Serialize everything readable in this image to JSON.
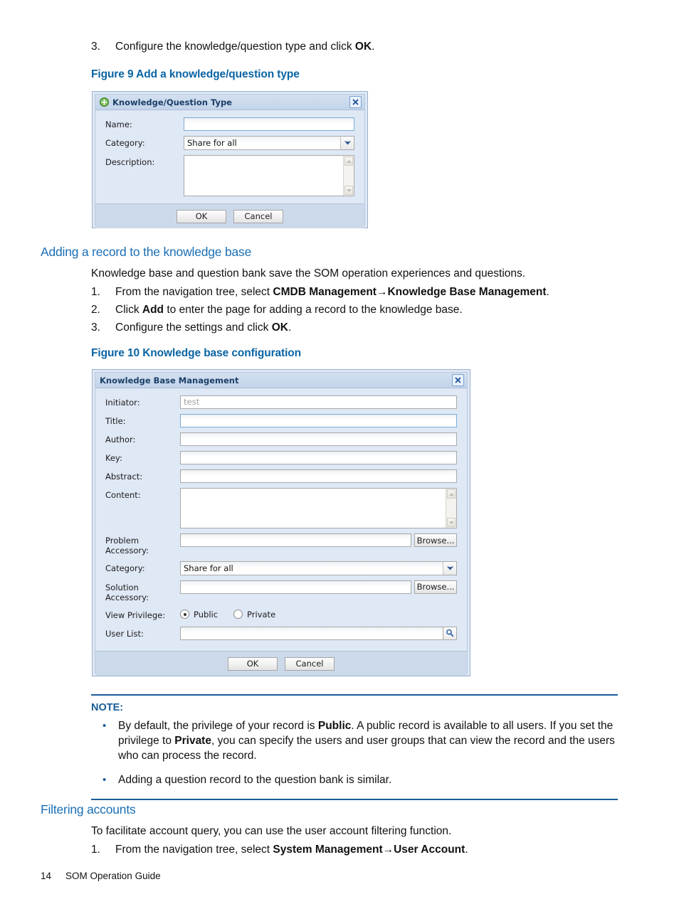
{
  "step_top": {
    "num": "3.",
    "text_before": "Configure the knowledge/question type and click ",
    "bold": "OK",
    "text_after": "."
  },
  "figure9": {
    "caption": "Figure 9 Add a knowledge/question type",
    "dialog": {
      "title": "Knowledge/Question Type",
      "title_icon": "add-plus-icon",
      "close_icon": "close-icon",
      "fields": {
        "name_label": "Name:",
        "name_value": "",
        "category_label": "Category:",
        "category_value": "Share for all",
        "description_label": "Description:",
        "description_value": ""
      },
      "buttons": {
        "ok": "OK",
        "cancel": "Cancel"
      }
    }
  },
  "section_adding": {
    "heading": "Adding a record to the knowledge base",
    "intro": "Knowledge base and question bank save the SOM operation experiences and questions.",
    "steps": [
      {
        "num": "1.",
        "pre": "From the navigation tree, select ",
        "bold": "CMDB Management→Knowledge Base Management",
        "post": "."
      },
      {
        "num": "2.",
        "pre": "Click ",
        "bold": "Add",
        "post": " to enter the page for adding a record to the knowledge base."
      },
      {
        "num": "3.",
        "pre": "Configure the settings and click ",
        "bold": "OK",
        "post": "."
      }
    ]
  },
  "figure10": {
    "caption": "Figure 10 Knowledge base configuration",
    "dialog": {
      "title": "Knowledge Base Management",
      "close_icon": "close-icon",
      "fields": {
        "initiator_label": "Initiator:",
        "initiator_value": "test",
        "title_label": "Title:",
        "title_value": "",
        "author_label": "Author:",
        "author_value": "",
        "key_label": "Key:",
        "key_value": "",
        "abstract_label": "Abstract:",
        "abstract_value": "",
        "content_label": "Content:",
        "content_value": "",
        "problem_accessory_label_l1": "Problem",
        "problem_accessory_label_l2": "Accessory:",
        "problem_accessory_value": "",
        "problem_browse": "Browse...",
        "category_label": "Category:",
        "category_value": "Share for all",
        "solution_accessory_label_l1": "Solution",
        "solution_accessory_label_l2": "Accessory:",
        "solution_accessory_value": "",
        "solution_browse": "Browse...",
        "view_privilege_label": "View Privilege:",
        "privilege_public": "Public",
        "privilege_private": "Private",
        "privilege_selected": "Public",
        "user_list_label": "User List:",
        "user_list_value": "",
        "user_list_search_icon": "search-icon"
      },
      "buttons": {
        "ok": "OK",
        "cancel": "Cancel"
      }
    }
  },
  "note": {
    "title": "NOTE:",
    "bullet": "•",
    "items": [
      {
        "p1": "By default, the privilege of your record is ",
        "b1": "Public",
        "p2": ". A public record is available to all users. If you set the privilege to ",
        "b2": "Private",
        "p3": ", you can specify the users and user groups that can view the record and the users who can process the record."
      },
      {
        "p1": "Adding a question record to the question bank is similar.",
        "b1": "",
        "p2": "",
        "b2": "",
        "p3": ""
      }
    ]
  },
  "section_filtering": {
    "heading": "Filtering accounts",
    "intro": "To facilitate account query, you can use the user account filtering function.",
    "steps": [
      {
        "num": "1.",
        "pre": "From the navigation tree, select ",
        "bold": "System Management→User Account",
        "post": "."
      }
    ]
  },
  "footer": {
    "page_number": "14",
    "guide_title": "SOM Operation Guide"
  },
  "colors": {
    "heading_blue": "#1a6fb5",
    "caption_blue": "#0a64a4",
    "note_blue": "#1a5c96",
    "dialog_bg": "#dfe8f5",
    "dialog_footer": "#ccd9ea",
    "title_bar": "#c3d4ea"
  }
}
